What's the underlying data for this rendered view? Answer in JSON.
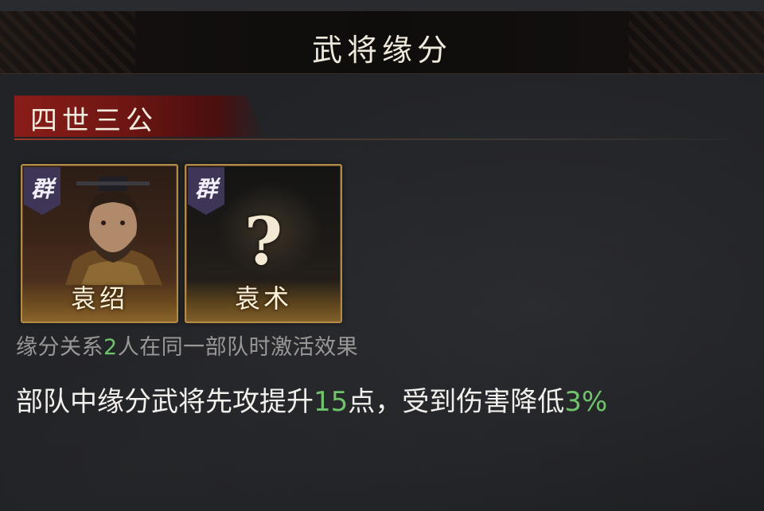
{
  "header": {
    "title": "武将缘分"
  },
  "section": {
    "title": "四世三公"
  },
  "generals": [
    {
      "faction": "群",
      "name": "袁绍",
      "portrait_icon": "general-portrait",
      "unknown": false
    },
    {
      "faction": "群",
      "name": "袁术",
      "portrait_icon": "question-mark-icon",
      "unknown": true,
      "placeholder_glyph": "?"
    }
  ],
  "condition": {
    "prefix": "缘分关系",
    "count": "2",
    "suffix": "人在同一部队时激活效果"
  },
  "effect": {
    "part1": "部队中缘分武将先攻提升",
    "value1": "15",
    "part2": "点，受到伤害降低",
    "value2": "3",
    "part3": "%"
  },
  "colors": {
    "highlight": "#6fc36b",
    "frame": "#b48a47",
    "faction_bg": "#3e3557",
    "section_red": "#8a1d19"
  }
}
